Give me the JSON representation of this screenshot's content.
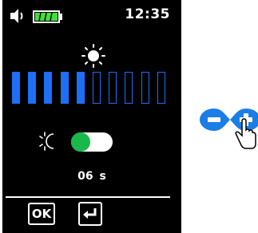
{
  "status_bar": {
    "time": "12:35",
    "volume_icon": "speaker-icon",
    "battery_icon": "battery-full-icon",
    "battery_level": 1.0,
    "battery_color": "#41e13b"
  },
  "brightness": {
    "icon": "sun-icon",
    "level": 5,
    "max": 10,
    "color": "#1e6ff5"
  },
  "auto_brightness": {
    "icon": "auto-brightness-icon",
    "enabled": true,
    "toggle_color": "#19b84a"
  },
  "timer": {
    "text": "06  s"
  },
  "footer": {
    "ok_label": "OK",
    "back_icon": "enter-return-icon"
  },
  "side_hint": {
    "icon": "minus-plus-touch-icon",
    "color": "#1b7ee6"
  }
}
